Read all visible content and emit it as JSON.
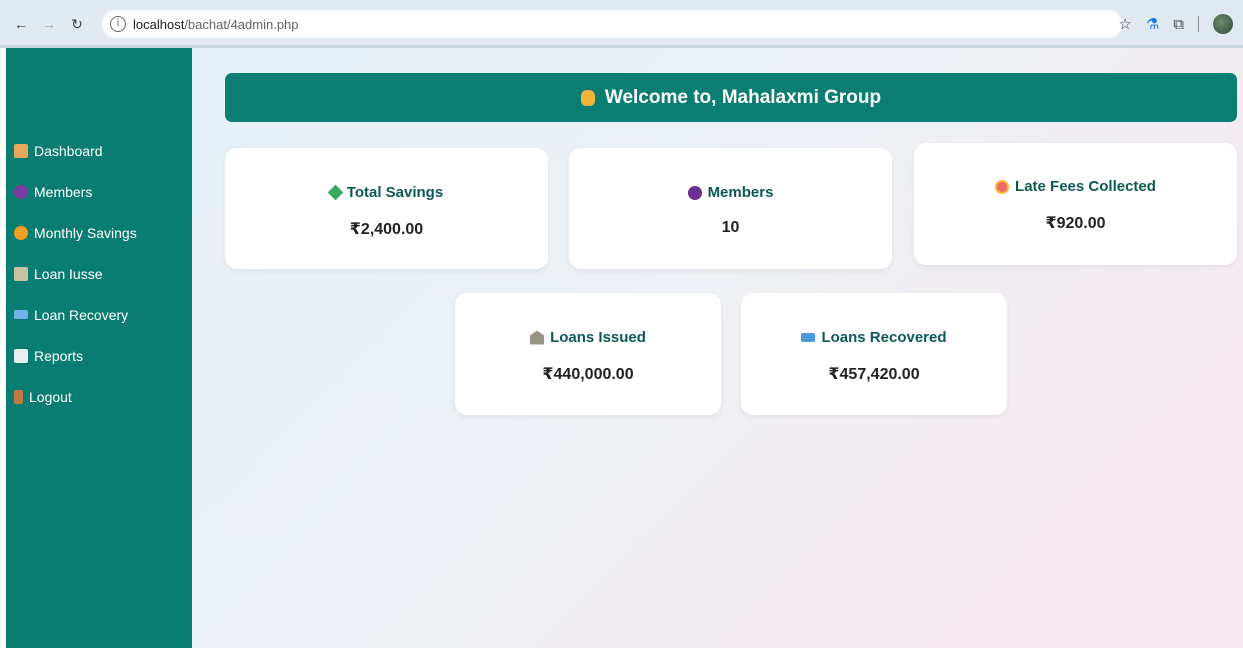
{
  "browser": {
    "url_host": "localhost",
    "url_path": "/bachat/4admin.php"
  },
  "sidebar": {
    "items": [
      {
        "label": "Dashboard",
        "icon": "house-icon"
      },
      {
        "label": "Members",
        "icon": "people-icon"
      },
      {
        "label": "Monthly Savings",
        "icon": "money-bag-icon"
      },
      {
        "label": "Loan Iusse",
        "icon": "bank-icon"
      },
      {
        "label": "Loan Recovery",
        "icon": "credit-card-icon"
      },
      {
        "label": "Reports",
        "icon": "document-icon"
      },
      {
        "label": "Logout",
        "icon": "door-icon"
      }
    ]
  },
  "header": {
    "welcome": "Welcome to, Mahalaxmi Group"
  },
  "cards": {
    "total_savings": {
      "title": "Total Savings",
      "value": "₹2,400.00"
    },
    "members": {
      "title": "Members",
      "value": "10"
    },
    "late_fees": {
      "title": "Late Fees Collected",
      "value": "₹920.00"
    },
    "loans_issued": {
      "title": "Loans Issued",
      "value": "₹440,000.00"
    },
    "loans_recovered": {
      "title": "Loans Recovered",
      "value": "₹457,420.00"
    }
  },
  "colors": {
    "sidebar": "#0a7d72",
    "header": "#0b7e73",
    "card_title": "#0c5a55"
  }
}
